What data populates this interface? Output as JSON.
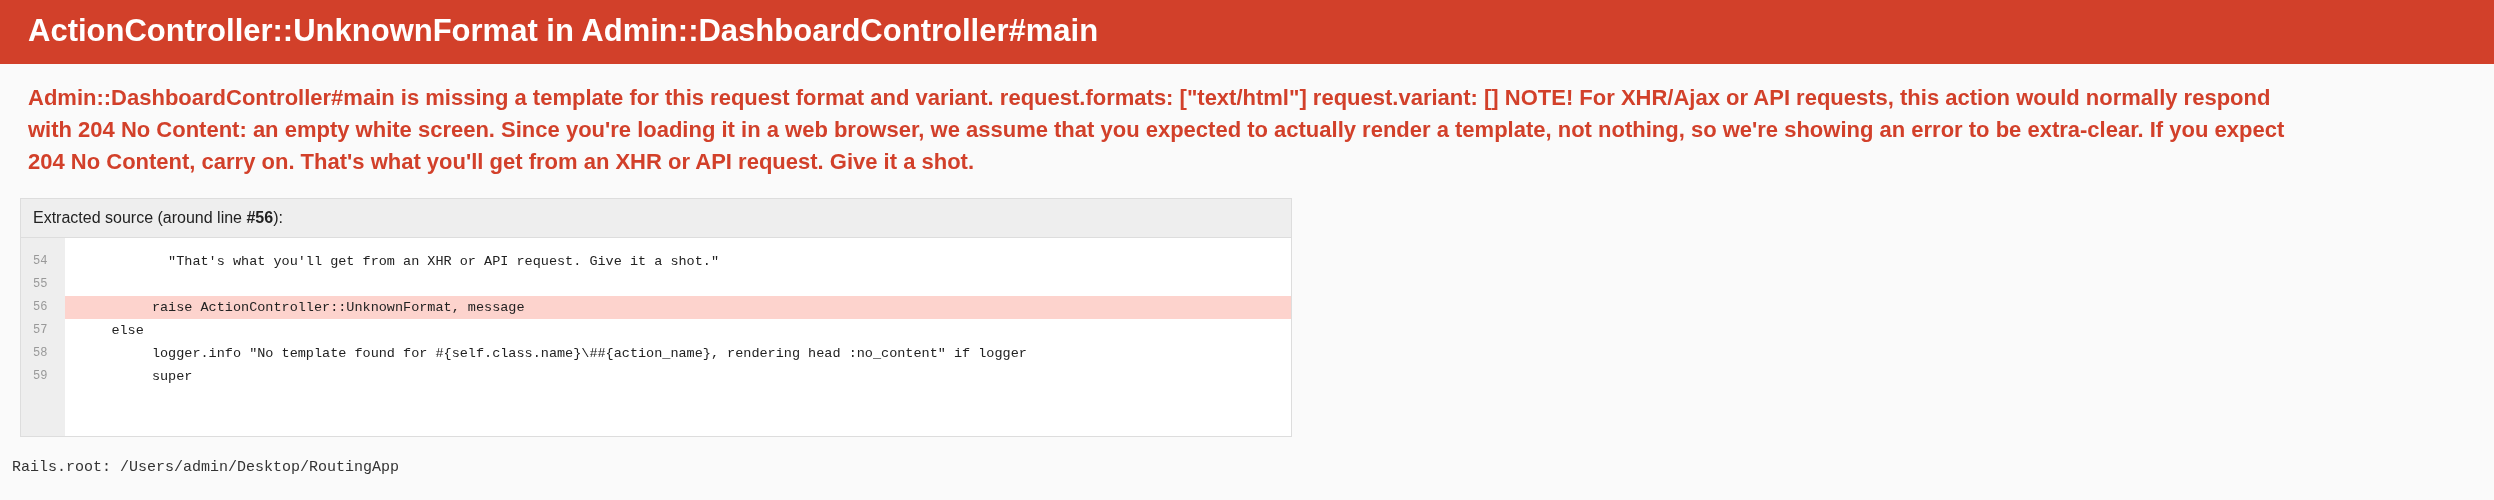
{
  "header": {
    "title": "ActionController::UnknownFormat in Admin::DashboardController#main"
  },
  "message": "Admin::DashboardController#main is missing a template for this request format and variant. request.formats: [\"text/html\"] request.variant: [] NOTE! For XHR/Ajax or API requests, this action would normally respond with 204 No Content: an empty white screen. Since you're loading it in a web browser, we assume that you expected to actually render a template, not nothing, so we're showing an error to be extra-clear. If you expect 204 No Content, carry on. That's what you'll get from an XHR or API request. Give it a shot.",
  "source": {
    "caption": "Extracted source (around line **#56**):",
    "lines": [
      {
        "number": "54",
        "code": "           \"That's what you'll get from an XHR or API request. Give it a shot.\"",
        "selected": false
      },
      {
        "number": "55",
        "selected": false
      },
      {
        "number": "56",
        "code": "         raise ActionController::UnknownFormat, message",
        "selected": true
      },
      {
        "number": "57",
        "code": "    else",
        "selected": false
      },
      {
        "number": "58",
        "code": "         logger.info \"No template found for #{self.class.name}\\##{action_name}, rendering head :no_content\" if logger",
        "selected": false
      },
      {
        "number": "59",
        "code": "         super",
        "selected": false
      }
    ]
  },
  "rails_root": "Rails.root: /Users/admin/Desktop/RoutingApp"
}
